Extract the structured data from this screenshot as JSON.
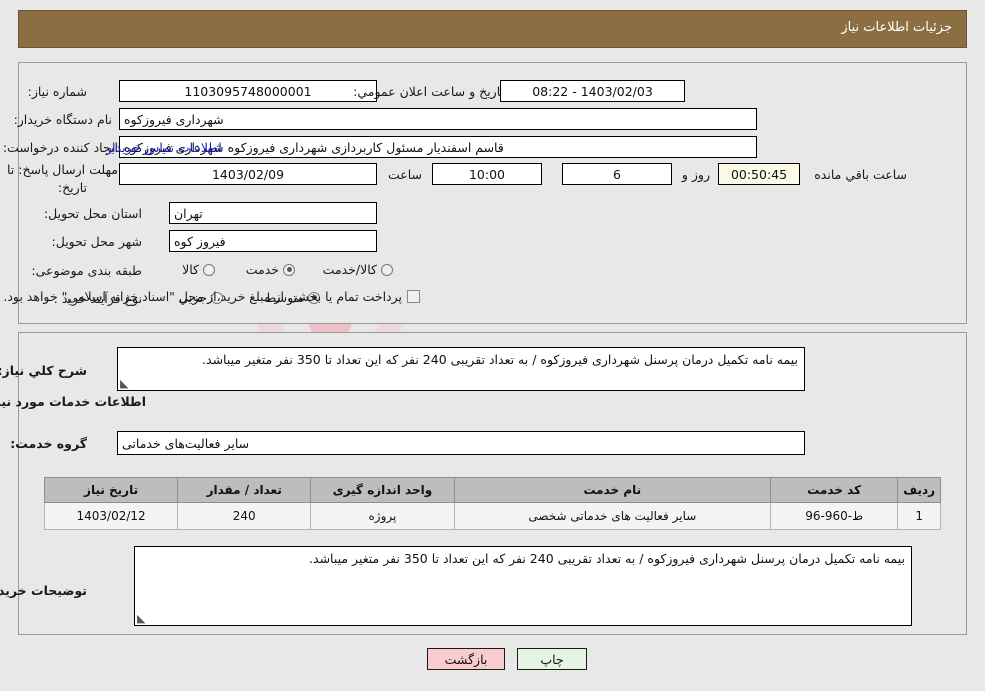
{
  "header": {
    "title": "جزئیات اطلاعات نیاز"
  },
  "top_panel": {
    "need_number_label": "شماره نیاز:",
    "need_number_value": "1103095748000001",
    "announce_datetime_label": "تاریخ و ساعت اعلان عمومي:",
    "announce_datetime_value": "1403/02/03 - 08:22",
    "buyer_org_label": "نام دستگاه خریدار:",
    "buyer_org_value": "شهرداری فیروزکوه",
    "request_creator_label": "ایجاد کننده درخواست:",
    "request_creator_value": "قاسم اسفندیار مسئول کاربردازی شهرداری فیروزکوه شهرداری فیروزکوه",
    "buyer_contact_link": "اطلاعات تماس خریدار",
    "deadline_label_line1": "مهلت ارسال پاسخ: تا",
    "deadline_label_line2": "تاریخ:",
    "deadline_date_value": "1403/02/09",
    "hour_label": "ساعت",
    "deadline_time_value": "10:00",
    "days_remaining_value": "6",
    "days_word": "روز و",
    "countdown_value": "00:50:45",
    "remaining_suffix": "ساعت باقي مانده",
    "province_label": "استان محل تحویل:",
    "province_value": "تهران",
    "city_label": "شهر محل تحویل:",
    "city_value": "فیروز کوه",
    "category_label": "طبقه بندی موضوعی:",
    "category_options": [
      {
        "label": "کالا",
        "selected": false
      },
      {
        "label": "خدمت",
        "selected": true
      },
      {
        "label": "کالا/خدمت",
        "selected": false
      }
    ],
    "purchase_type_label": "نوع فرآیند خرید :",
    "purchase_type_options": [
      {
        "label": "جزیي",
        "selected": false
      },
      {
        "label": "متوسط",
        "selected": true
      }
    ],
    "treasury_checkbox_label": "پرداخت تمام یا بخشی از مبلغ خرید،از محل \"اسناد خزانه اسلامی\" خواهد بود.",
    "treasury_checked": false
  },
  "mid_panel": {
    "general_desc_label": "شرح کلي نیاز:",
    "general_desc_value": "بیمه نامه تکمیل درمان پرسنل شهرداری فیروزکوه / به تعداد تقریبی 240 نفر که این تعداد تا 350 نفر متغیر میباشد.",
    "services_info_heading": "اطلاعات خدمات مورد نیاز",
    "service_group_label": "گروه خدمت:",
    "service_group_value": "سایر فعالیت‌های خدماتی",
    "table": {
      "headers": [
        "ردیف",
        "کد خدمت",
        "نام خدمت",
        "واحد اندازه گیری",
        "تعداد / مقدار",
        "تاریخ نیاز"
      ],
      "rows": [
        {
          "row_no": "1",
          "service_code": "ط-960-96",
          "service_name": "سایر فعالیت های خدماتی شخصی",
          "unit": "پروژه",
          "quantity": "240",
          "need_date": "1403/02/12"
        }
      ]
    },
    "buyer_notes_label": "توضیحات خریدار:",
    "buyer_notes_value": "بیمه نامه تکمیل درمان پرسنل شهرداری فیروزکوه / به تعداد تقریبی 240 نفر که این تعداد تا 350 نفر متغیر میباشد."
  },
  "footer": {
    "print_label": "چاپ",
    "back_label": "بازگشت"
  },
  "watermark": {
    "text": "AriaTender.net"
  },
  "colors": {
    "header_bar": "#8c6e43",
    "link": "#1414cc",
    "table_header": "#bdbdbd",
    "print_button": "#e4f5e4",
    "back_button": "#f8ccce",
    "timer_field": "#fbfbe8"
  }
}
